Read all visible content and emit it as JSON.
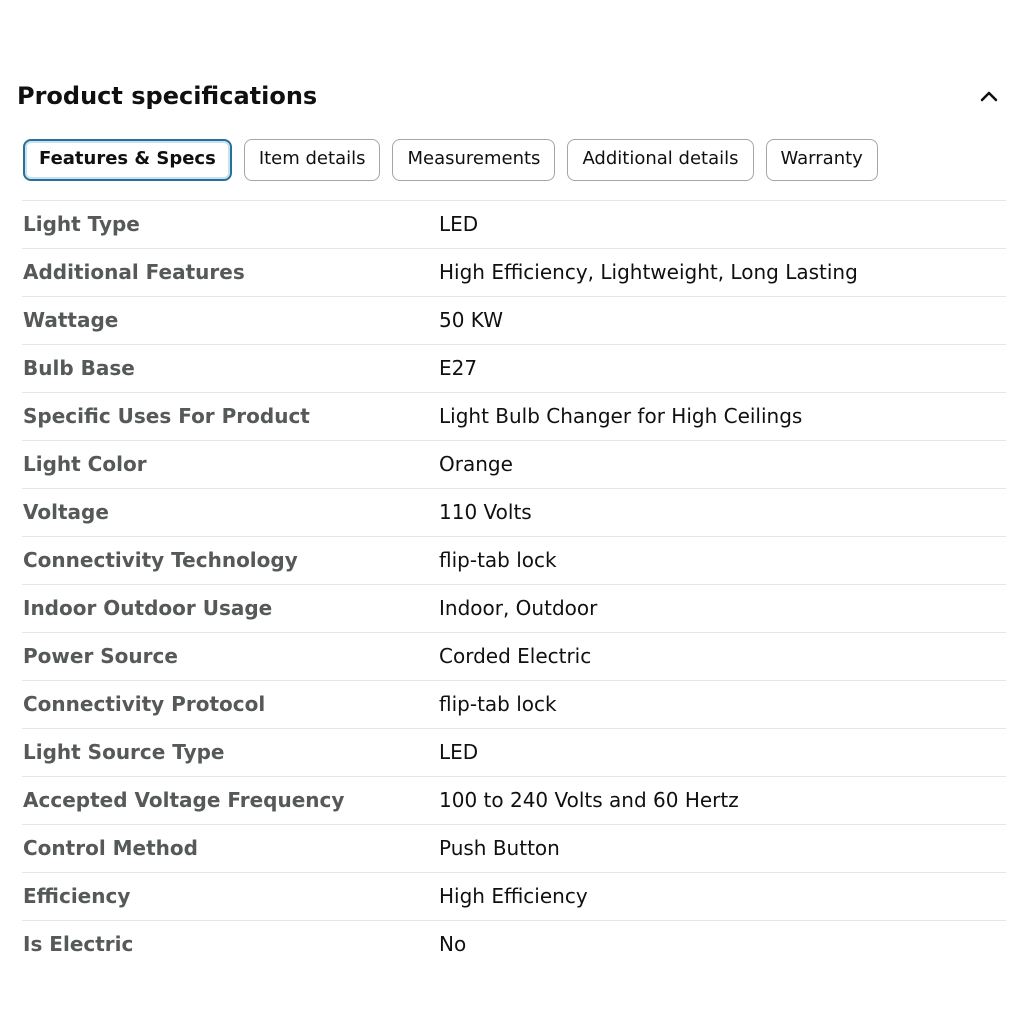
{
  "header": {
    "title": "Product specifications",
    "collapse_icon": "chevron-up-icon"
  },
  "tabs": [
    {
      "label": "Features & Specs",
      "active": true
    },
    {
      "label": "Item details",
      "active": false
    },
    {
      "label": "Measurements",
      "active": false
    },
    {
      "label": "Additional details",
      "active": false
    },
    {
      "label": "Warranty",
      "active": false
    }
  ],
  "specs": [
    {
      "name": "Light Type",
      "value": "LED"
    },
    {
      "name": "Additional Features",
      "value": "High Efficiency, Lightweight, Long Lasting"
    },
    {
      "name": "Wattage",
      "value": "50 KW"
    },
    {
      "name": "Bulb Base",
      "value": "E27"
    },
    {
      "name": "Specific Uses For Product",
      "value": "Light Bulb Changer for High Ceilings"
    },
    {
      "name": "Light Color",
      "value": "Orange"
    },
    {
      "name": "Voltage",
      "value": "110 Volts"
    },
    {
      "name": "Connectivity Technology",
      "value": "flip-tab lock"
    },
    {
      "name": "Indoor Outdoor Usage",
      "value": "Indoor, Outdoor"
    },
    {
      "name": "Power Source",
      "value": "Corded Electric"
    },
    {
      "name": "Connectivity Protocol",
      "value": "flip-tab lock"
    },
    {
      "name": "Light Source Type",
      "value": "LED"
    },
    {
      "name": "Accepted Voltage Frequency",
      "value": "100 to 240 Volts and 60 Hertz"
    },
    {
      "name": "Control Method",
      "value": "Push Button"
    },
    {
      "name": "Efficiency",
      "value": "High Efficiency"
    },
    {
      "name": "Is Electric",
      "value": "No"
    }
  ]
}
